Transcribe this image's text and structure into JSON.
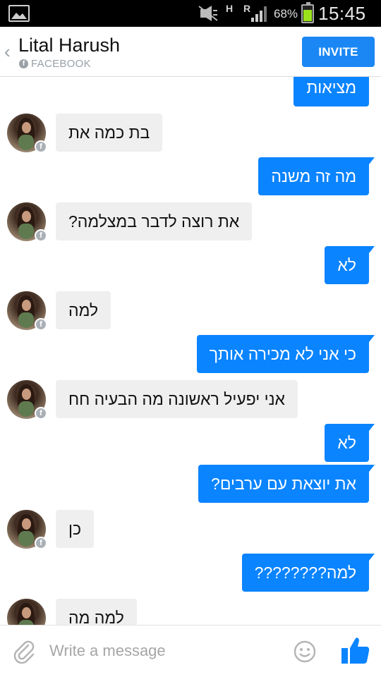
{
  "status_bar": {
    "battery_text": "68%",
    "battery_level": 0.68,
    "clock": "15:45",
    "network_h1": "H",
    "network_h2": "R",
    "icons": [
      "gallery-icon",
      "mute-icon",
      "signal-icon",
      "battery-icon"
    ]
  },
  "header": {
    "back_icon": "‹",
    "title": "Lital Harush",
    "subtitle": "FACEBOOK",
    "fb_icon": "f",
    "invite_label": "INVITE"
  },
  "messages": [
    {
      "side": "sent",
      "text": "מציאות"
    },
    {
      "side": "received",
      "text": "בת כמה את"
    },
    {
      "side": "sent",
      "text": "מה זה משנה"
    },
    {
      "side": "received",
      "text": "את רוצה לדבר במצלמה?"
    },
    {
      "side": "sent",
      "text": "לא"
    },
    {
      "side": "received",
      "text": "למה"
    },
    {
      "side": "sent",
      "text": "כי אני לא מכירה אותך"
    },
    {
      "side": "received",
      "text": "אני יפעיל ראשונה מה הבעיה חח"
    },
    {
      "side": "sent",
      "text": "לא"
    },
    {
      "side": "sent",
      "text": "את יוצאת עם ערבים?"
    },
    {
      "side": "received",
      "text": "כן"
    },
    {
      "side": "sent",
      "text": "למה????????"
    },
    {
      "side": "received",
      "text": "למה מה"
    }
  ],
  "composer": {
    "placeholder": "Write a message",
    "icons": [
      "attach-icon",
      "emoji-icon",
      "like-icon"
    ]
  },
  "colors": {
    "accent": "#0a84ff",
    "invite": "#1a87f5",
    "received_bubble": "#efefef",
    "battery_fill": "#9be21b"
  }
}
